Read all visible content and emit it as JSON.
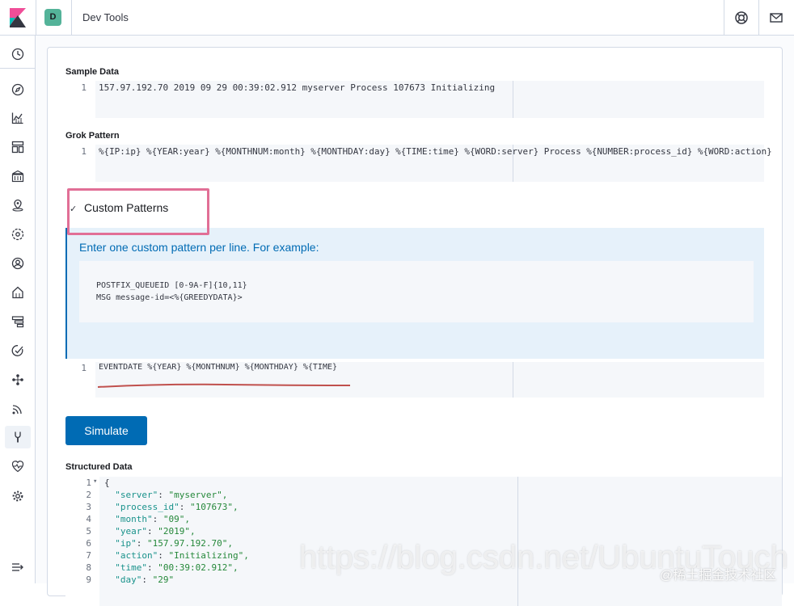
{
  "header": {
    "space_initial": "D",
    "app_title": "Dev Tools",
    "icons": [
      "help-icon",
      "mail-icon"
    ],
    "logo": "kibana-logo"
  },
  "sidebar": {
    "items": [
      {
        "icon": "clock-icon",
        "label": "Recently viewed"
      },
      {
        "icon": "compass-icon",
        "label": "Discover"
      },
      {
        "icon": "visualize-icon",
        "label": "Visualize"
      },
      {
        "icon": "dashboard-icon",
        "label": "Dashboard"
      },
      {
        "icon": "canvas-icon",
        "label": "Canvas"
      },
      {
        "icon": "maps-icon",
        "label": "Maps"
      },
      {
        "icon": "ml-icon",
        "label": "Machine Learning"
      },
      {
        "icon": "infra-icon",
        "label": "Infrastructure"
      },
      {
        "icon": "logs-icon",
        "label": "Logs"
      },
      {
        "icon": "apm-icon",
        "label": "APM"
      },
      {
        "icon": "uptime-icon",
        "label": "Uptime"
      },
      {
        "icon": "siem-icon",
        "label": "SIEM"
      },
      {
        "icon": "graph-icon",
        "label": "Graph"
      },
      {
        "icon": "signal-icon",
        "label": "Metrics"
      },
      {
        "icon": "devtools-icon",
        "label": "Dev Tools"
      },
      {
        "icon": "monitoring-icon",
        "label": "Monitoring"
      },
      {
        "icon": "gear-icon",
        "label": "Management"
      }
    ],
    "collapse_icon": "menu-collapse-icon"
  },
  "sample_data": {
    "label": "Sample Data",
    "lines": [
      {
        "n": "1",
        "text": "157.97.192.70 2019 09 29 00:39:02.912 myserver Process 107673 Initializing"
      }
    ]
  },
  "grok_pattern": {
    "label": "Grok Pattern",
    "lines": [
      {
        "n": "1",
        "text": "%{IP:ip} %{YEAR:year} %{MONTHNUM:month} %{MONTHDAY:day} %{TIME:time} %{WORD:server} Process %{NUMBER:process_id} %{WORD:action}"
      }
    ]
  },
  "custom_patterns": {
    "toggle_label": "Custom Patterns",
    "callout_title": "Enter one custom pattern per line. For example:",
    "example": "POSTFIX_QUEUEID [0-9A-F]{10,11}\nMSG message-id=<%{GREEDYDATA}>",
    "lines": [
      {
        "n": "1",
        "text": "EVENTDATE %{YEAR} %{MONTHNUM} %{MONTHDAY} %{TIME}"
      }
    ]
  },
  "simulate_button": "Simulate",
  "structured_data": {
    "label": "Structured Data",
    "lines": [
      {
        "n": "1",
        "fold": "▾",
        "open": "{"
      },
      {
        "n": "2",
        "key": "\"server\"",
        "value": "\"myserver\","
      },
      {
        "n": "3",
        "key": "\"process_id\"",
        "value": "\"107673\","
      },
      {
        "n": "4",
        "key": "\"month\"",
        "value": "\"09\","
      },
      {
        "n": "5",
        "key": "\"year\"",
        "value": "\"2019\","
      },
      {
        "n": "6",
        "key": "\"ip\"",
        "value": "\"157.97.192.70\","
      },
      {
        "n": "7",
        "key": "\"action\"",
        "value": "\"Initializing\","
      },
      {
        "n": "8",
        "key": "\"time\"",
        "value": "\"00:39:02.912\","
      },
      {
        "n": "9",
        "key": "\"day\"",
        "value": "\"29\""
      }
    ]
  },
  "watermark": {
    "main": "https://blog.csdn.net/UbuntuTouch",
    "secondary": "@稀土掘金技术社区"
  },
  "colors": {
    "accent": "#006bb4",
    "highlight_box": "#e16f96",
    "underline": "#c0504d",
    "json_key": "#19928b",
    "json_string": "#25883a"
  }
}
